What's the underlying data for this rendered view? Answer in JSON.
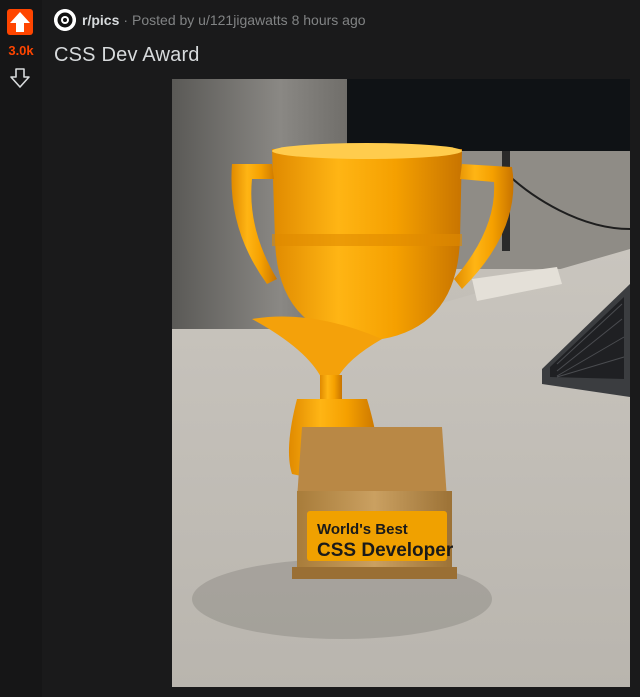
{
  "vote": {
    "score": "3.0k",
    "upvoted": true,
    "accent": "#ff4500"
  },
  "post": {
    "subreddit": "r/pics",
    "separator": "·",
    "posted_by": "Posted by u/121jigawatts 8 hours ago",
    "title": "CSS Dev Award",
    "image_text_line1": "World's Best",
    "image_text_line2": "CSS Developer"
  },
  "colors": {
    "background": "#1a1a1b",
    "text": "#d7dadc",
    "muted": "#818384"
  }
}
